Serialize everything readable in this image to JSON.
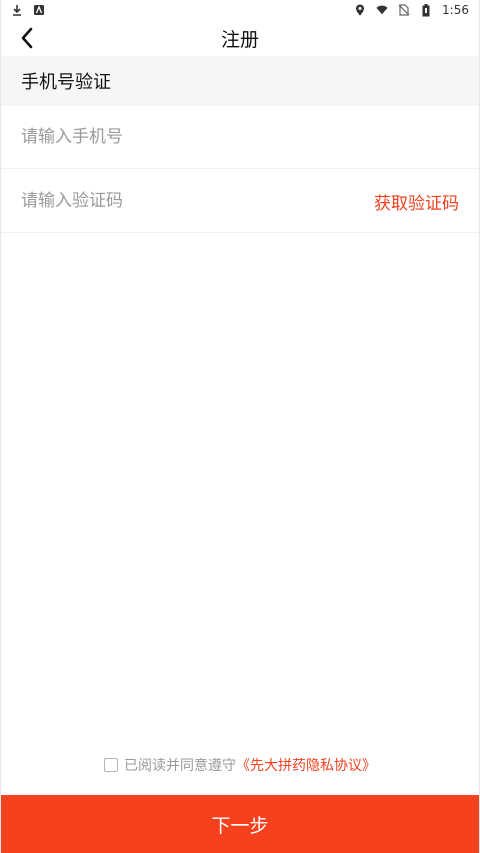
{
  "status_bar": {
    "time": "1:56",
    "left_icons": [
      "download-icon",
      "app-notification-icon"
    ],
    "right_icons": [
      "location-icon",
      "wifi-icon",
      "no-sim-icon",
      "battery-icon"
    ]
  },
  "header": {
    "title": "注册",
    "back_icon": "chevron-left-icon"
  },
  "section": {
    "title": "手机号验证"
  },
  "form": {
    "phone_placeholder": "请输入手机号",
    "phone_value": "",
    "code_placeholder": "请输入验证码",
    "code_value": "",
    "get_code_label": "获取验证码"
  },
  "agreement": {
    "checked": false,
    "text": "已阅读并同意遵守",
    "link_text": "《先大拼药隐私协议》"
  },
  "footer": {
    "next_label": "下一步"
  },
  "colors": {
    "accent": "#f6411f",
    "link": "#f2421f",
    "section_bg": "#f6f6f6",
    "placeholder": "#9a9a9a"
  }
}
